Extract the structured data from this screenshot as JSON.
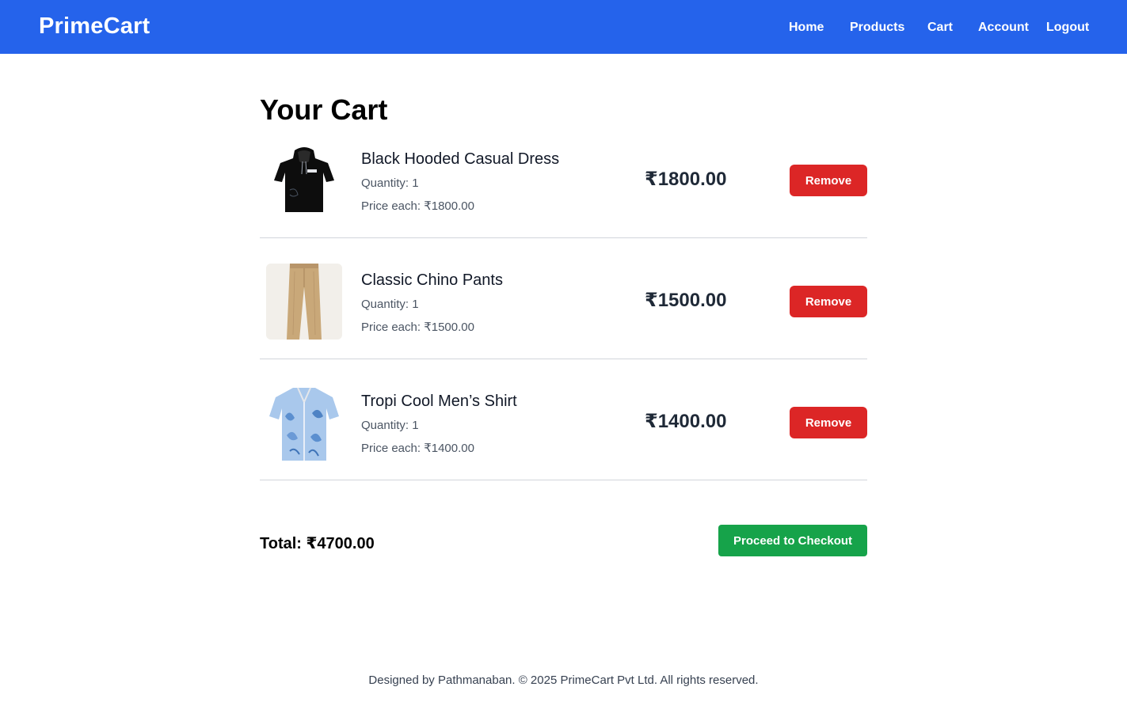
{
  "brand": "PrimeCart",
  "nav": {
    "home": "Home",
    "products": "Products",
    "cart": "Cart",
    "account": "Account",
    "logout": "Logout"
  },
  "page_title": "Your Cart",
  "items": [
    {
      "name": "Black Hooded Casual Dress",
      "quantity": "Quantity: 1",
      "price_each": "Price each: ₹1800.00",
      "subtotal": "₹1800.00",
      "remove_label": "Remove",
      "image_icon": "black-hoodie-image"
    },
    {
      "name": "Classic Chino Pants",
      "quantity": "Quantity: 1",
      "price_each": "Price each: ₹1500.00",
      "subtotal": "₹1500.00",
      "remove_label": "Remove",
      "image_icon": "chino-pants-image"
    },
    {
      "name": "Tropi Cool Men’s Shirt",
      "quantity": "Quantity: 1",
      "price_each": "Price each: ₹1400.00",
      "subtotal": "₹1400.00",
      "remove_label": "Remove",
      "image_icon": "tropical-shirt-image"
    }
  ],
  "total": "Total: ₹4700.00",
  "checkout_label": "Proceed to Checkout",
  "footer": "Designed by Pathmanaban. © 2025 PrimeCart Pvt Ltd. All rights reserved.",
  "colors": {
    "nav_bg": "#2563eb",
    "remove_btn": "#dc2626",
    "checkout_btn": "#16a34a"
  }
}
